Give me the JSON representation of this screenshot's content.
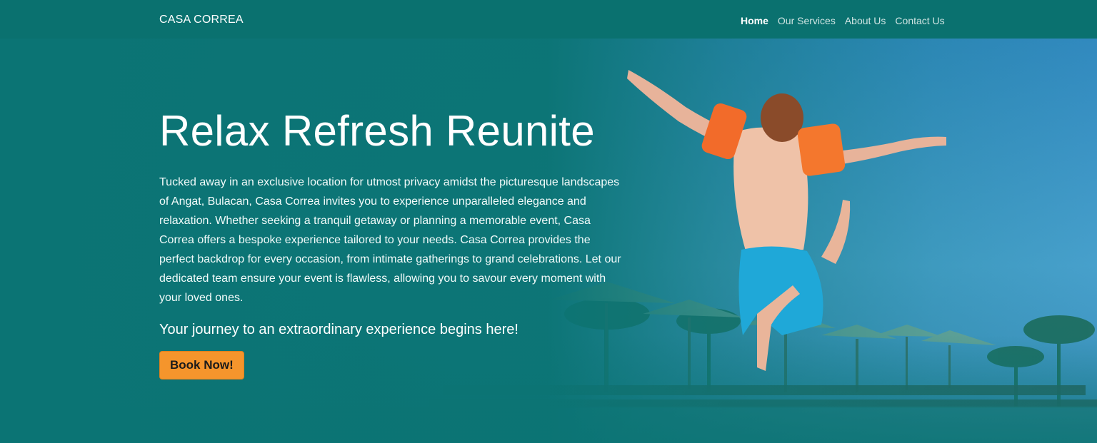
{
  "brand": {
    "name": "CASA CORREA"
  },
  "nav": {
    "items": [
      {
        "label": "Home",
        "active": true
      },
      {
        "label": "Our Services",
        "active": false
      },
      {
        "label": "About Us",
        "active": false
      },
      {
        "label": "Contact Us",
        "active": false
      }
    ]
  },
  "hero": {
    "title": "Relax Refresh Reunite",
    "text": "Tucked away in an exclusive location for utmost privacy amidst the picturesque landscapes of Angat, Bulacan, Casa Correa invites you to experience unparalleled elegance and relaxation. Whether seeking a tranquil getaway or planning a memorable event, Casa Correa offers a bespoke experience tailored to your needs. Casa Correa provides the perfect backdrop for every occasion, from intimate gatherings to grand celebrations. Let our dedicated team ensure your event is flawless, allowing you to savour every moment with your loved ones.",
    "tagline": "Your journey to an extraordinary experience begins here!",
    "cta_label": "Book Now!"
  },
  "colors": {
    "primary": "#0a716f",
    "accent": "#f5952c",
    "sky": "#3a8fc4"
  }
}
